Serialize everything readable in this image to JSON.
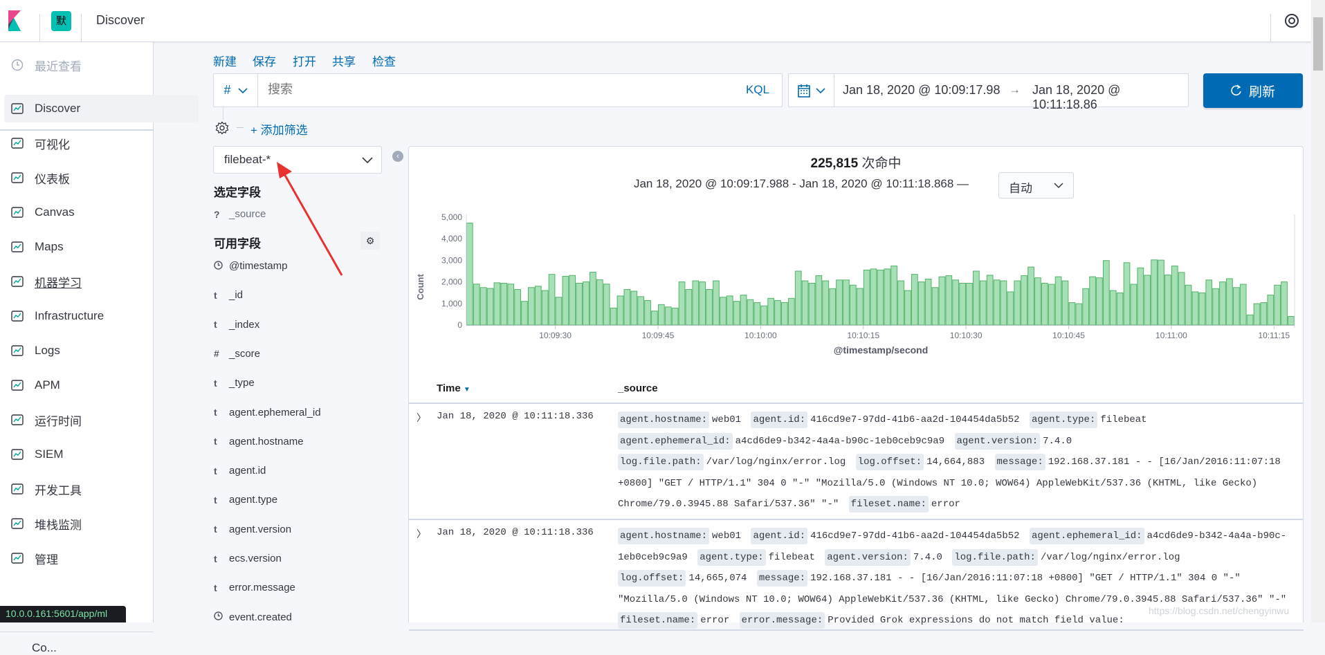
{
  "header": {
    "space_badge": "默",
    "app_title": "Discover",
    "help_icon": "lifebuoy-icon"
  },
  "nav": {
    "recent": "最近查看",
    "items": [
      {
        "label": "Discover",
        "icon": "compass-icon",
        "active": true
      },
      {
        "label": "可视化",
        "icon": "visualize-icon"
      },
      {
        "label": "仪表板",
        "icon": "dashboard-icon"
      },
      {
        "label": "Canvas",
        "icon": "canvas-icon"
      },
      {
        "label": "Maps",
        "icon": "maps-icon"
      },
      {
        "label": "机器学习",
        "icon": "machine-learning-icon",
        "hover": true
      },
      {
        "label": "Infrastructure",
        "icon": "infrastructure-icon"
      },
      {
        "label": "Logs",
        "icon": "logs-icon"
      },
      {
        "label": "APM",
        "icon": "apm-icon"
      },
      {
        "label": "运行时间",
        "icon": "uptime-icon"
      },
      {
        "label": "SIEM",
        "icon": "siem-icon"
      },
      {
        "label": "开发工具",
        "icon": "devtools-icon"
      },
      {
        "label": "堆栈监测",
        "icon": "monitoring-icon"
      },
      {
        "label": "管理",
        "icon": "gear-icon"
      }
    ],
    "bottom_partial": "Co..."
  },
  "status_url": "10.0.0.161:5601/app/ml",
  "topmenu": {
    "new": "新建",
    "save": "保存",
    "open": "打开",
    "share": "共享",
    "inspect": "检查"
  },
  "query": {
    "lang_symbol": "#",
    "placeholder": "搜索",
    "kql": "KQL"
  },
  "datepicker": {
    "start": "Jan 18, 2020 @ 10:09:17.98",
    "arrow": "→",
    "end": "Jan 18, 2020 @ 10:11:18.86"
  },
  "refresh_label": "刷新",
  "add_filter": "+ 添加筛选",
  "index_pattern": "filebeat-*",
  "fields": {
    "selected_title": "选定字段",
    "selected": [
      {
        "type": "?",
        "name": "_source"
      }
    ],
    "available_title": "可用字段",
    "available": [
      {
        "type": "clock",
        "name": "@timestamp"
      },
      {
        "type": "t",
        "name": "_id"
      },
      {
        "type": "t",
        "name": "_index"
      },
      {
        "type": "#",
        "name": "_score"
      },
      {
        "type": "t",
        "name": "_type"
      },
      {
        "type": "t",
        "name": "agent.ephemeral_id"
      },
      {
        "type": "t",
        "name": "agent.hostname"
      },
      {
        "type": "t",
        "name": "agent.id"
      },
      {
        "type": "t",
        "name": "agent.type"
      },
      {
        "type": "t",
        "name": "agent.version"
      },
      {
        "type": "t",
        "name": "ecs.version"
      },
      {
        "type": "t",
        "name": "error.message"
      },
      {
        "type": "clock",
        "name": "event.created"
      }
    ]
  },
  "hits": {
    "count": "225,815",
    "suffix": "次命中",
    "range": "Jan 18, 2020 @ 10:09:17.988 - Jan 18, 2020 @ 10:11:18.868 —",
    "interval": "自动"
  },
  "chart_data": {
    "type": "bar",
    "xlabel": "@timestamp/second",
    "ylabel": "Count",
    "ylim": [
      0,
      5000
    ],
    "yticks": [
      "0",
      "1,000",
      "2,000",
      "3,000",
      "4,000",
      "5,000"
    ],
    "xticks": [
      "10:09:30",
      "10:09:45",
      "10:10:00",
      "10:10:15",
      "10:10:30",
      "10:10:45",
      "10:11:00",
      "10:11:15"
    ],
    "x_start": "10:09:17",
    "x_end": "10:11:18",
    "interval": "1 second",
    "color": "#54b399",
    "values": [
      4730,
      1900,
      1740,
      1700,
      1960,
      1940,
      1900,
      1650,
      1100,
      1740,
      1800,
      1600,
      2350,
      1290,
      2260,
      2300,
      1940,
      2000,
      2450,
      2100,
      1900,
      790,
      1350,
      1650,
      1570,
      1320,
      1140,
      650,
      950,
      840,
      790,
      2000,
      1650,
      2050,
      2000,
      1650,
      2050,
      1290,
      1350,
      1100,
      1390,
      1180,
      1040,
      890,
      1240,
      1140,
      1040,
      1240,
      2500,
      2050,
      1940,
      2290,
      2050,
      1690,
      2090,
      2090,
      1850,
      1700,
      2550,
      2600,
      2550,
      2600,
      2740,
      2050,
      1600,
      2350,
      2000,
      2130,
      1740,
      2240,
      2290,
      2090,
      1940,
      1940,
      2500,
      2050,
      2310,
      2090,
      2050,
      1540,
      2050,
      2290,
      2690,
      2190,
      1940,
      1890,
      2240,
      2050,
      1040,
      990,
      1690,
      2240,
      2190,
      2990,
      1600,
      1490,
      2890,
      1890,
      2650,
      2310,
      3020,
      3010,
      2320,
      2740,
      2440,
      1850,
      1540,
      1490,
      2090,
      1690,
      2000,
      2150,
      1740,
      1890,
      470,
      990,
      1040,
      1390,
      1850,
      2000,
      400
    ]
  },
  "table": {
    "col_time": "Time",
    "col_source": "_source",
    "rows": [
      {
        "time": "Jan 18, 2020 @ 10:11:18.336",
        "pairs": [
          [
            "agent.hostname:",
            "web01"
          ],
          [
            "agent.id:",
            "416cd9e7-97dd-41b6-aa2d-104454da5b52"
          ],
          [
            "agent.type:",
            "filebeat"
          ],
          [
            "agent.ephemeral_id:",
            "a4cd6de9-b342-4a4a-b90c-1eb0ceb9c9a9"
          ],
          [
            "agent.version:",
            "7.4.0"
          ],
          [
            "log.file.path:",
            "/var/log/nginx/error.log"
          ],
          [
            "log.offset:",
            "14,664,883"
          ],
          [
            "message:",
            "192.168.37.181 - - [16/Jan/2016:11:07:18 +0800] \"GET / HTTP/1.1\" 304 0 \"-\" \"Mozilla/5.0 (Windows NT 10.0; WOW64) AppleWebKit/537.36 (KHTML, like Gecko) Chrome/79.0.3945.88 Safari/537.36\" \"-\""
          ],
          [
            "fileset.name:",
            "error"
          ]
        ]
      },
      {
        "time": "Jan 18, 2020 @ 10:11:18.336",
        "pairs": [
          [
            "agent.hostname:",
            "web01"
          ],
          [
            "agent.id:",
            "416cd9e7-97dd-41b6-aa2d-104454da5b52"
          ],
          [
            "agent.ephemeral_id:",
            "a4cd6de9-b342-4a4a-b90c-1eb0ceb9c9a9"
          ],
          [
            "agent.type:",
            "filebeat"
          ],
          [
            "agent.version:",
            "7.4.0"
          ],
          [
            "log.file.path:",
            "/var/log/nginx/error.log"
          ],
          [
            "log.offset:",
            "14,665,074"
          ],
          [
            "message:",
            "192.168.37.181 - - [16/Jan/2016:11:07:18 +0800] \"GET / HTTP/1.1\" 304 0 \"-\" \"Mozilla/5.0 (Windows NT 10.0; WOW64) AppleWebKit/537.36 (KHTML, like Gecko) Chrome/79.0.3945.88 Safari/537.36\" \"-\""
          ],
          [
            "fileset.name:",
            "error"
          ],
          [
            "error.message:",
            "Provided Grok expressions do not match field value:"
          ]
        ]
      }
    ]
  },
  "watermark": "https://blog.csdn.net/chengyinwu"
}
